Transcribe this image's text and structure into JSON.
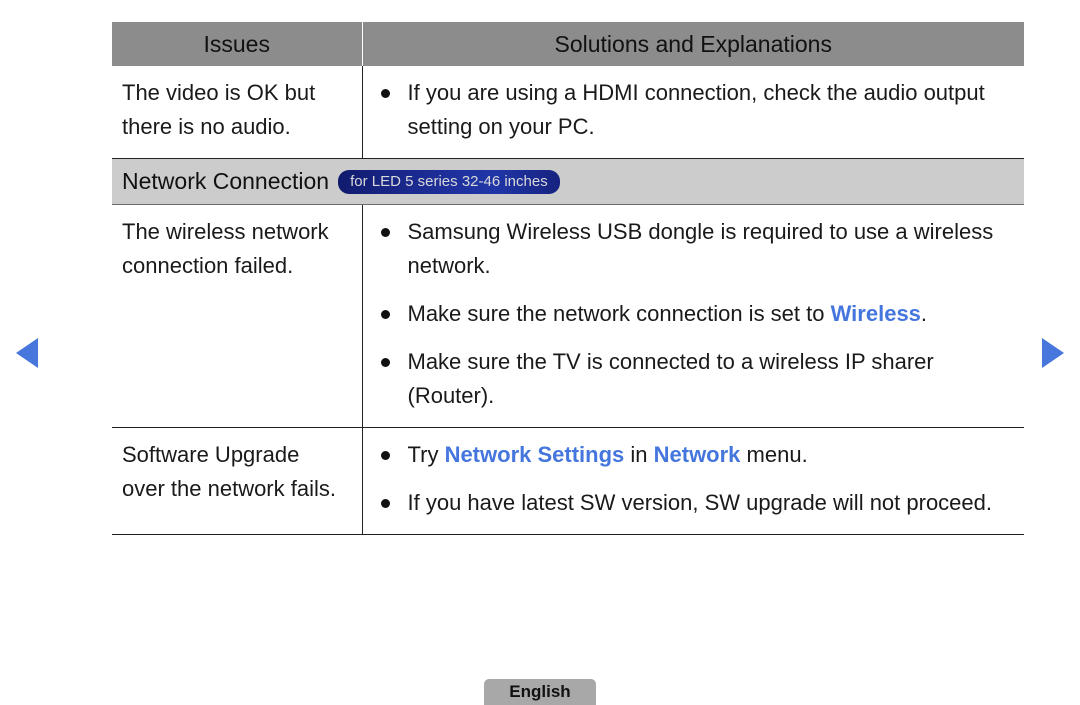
{
  "nav": {
    "prev_label": "previous page",
    "next_label": "next page"
  },
  "table": {
    "headers": {
      "issues": "Issues",
      "solutions": "Solutions and Explanations"
    },
    "rows": [
      {
        "type": "data",
        "issue": "The video is OK but there is no audio.",
        "bullets": [
          {
            "segments": [
              {
                "text": "If you are using a HDMI connection, check the audio output setting on your PC.",
                "style": "normal"
              }
            ]
          }
        ]
      },
      {
        "type": "section",
        "title": "Network Connection",
        "badge": "for LED 5 series 32-46 inches"
      },
      {
        "type": "data",
        "issue": "The wireless network connection failed.",
        "bullets": [
          {
            "segments": [
              {
                "text": "Samsung Wireless USB dongle is required to use a wireless network.",
                "style": "normal"
              }
            ]
          },
          {
            "segments": [
              {
                "text": "Make sure the network connection is set to ",
                "style": "normal"
              },
              {
                "text": "Wireless",
                "style": "highlight"
              },
              {
                "text": ".",
                "style": "normal"
              }
            ]
          },
          {
            "segments": [
              {
                "text": "Make sure the TV is connected to a wireless IP sharer (Router).",
                "style": "normal"
              }
            ]
          }
        ]
      },
      {
        "type": "data",
        "issue": "Software Upgrade over the network fails.",
        "bullets": [
          {
            "segments": [
              {
                "text": "Try ",
                "style": "normal"
              },
              {
                "text": "Network Settings",
                "style": "highlight"
              },
              {
                "text": " in ",
                "style": "normal"
              },
              {
                "text": "Network",
                "style": "highlight"
              },
              {
                "text": " menu.",
                "style": "normal"
              }
            ]
          },
          {
            "segments": [
              {
                "text": "If you have latest SW version, SW upgrade will not proceed.",
                "style": "normal"
              }
            ]
          }
        ]
      }
    ]
  },
  "footer": {
    "language": "English"
  },
  "colors": {
    "header_gray": "#8c8c8c",
    "section_gray": "#cccccc",
    "accent_blue": "#4476dd",
    "badge_blue": "#1b2a90",
    "arrow_blue": "#4776dd",
    "lang_button_gray": "#a8a8a8"
  }
}
